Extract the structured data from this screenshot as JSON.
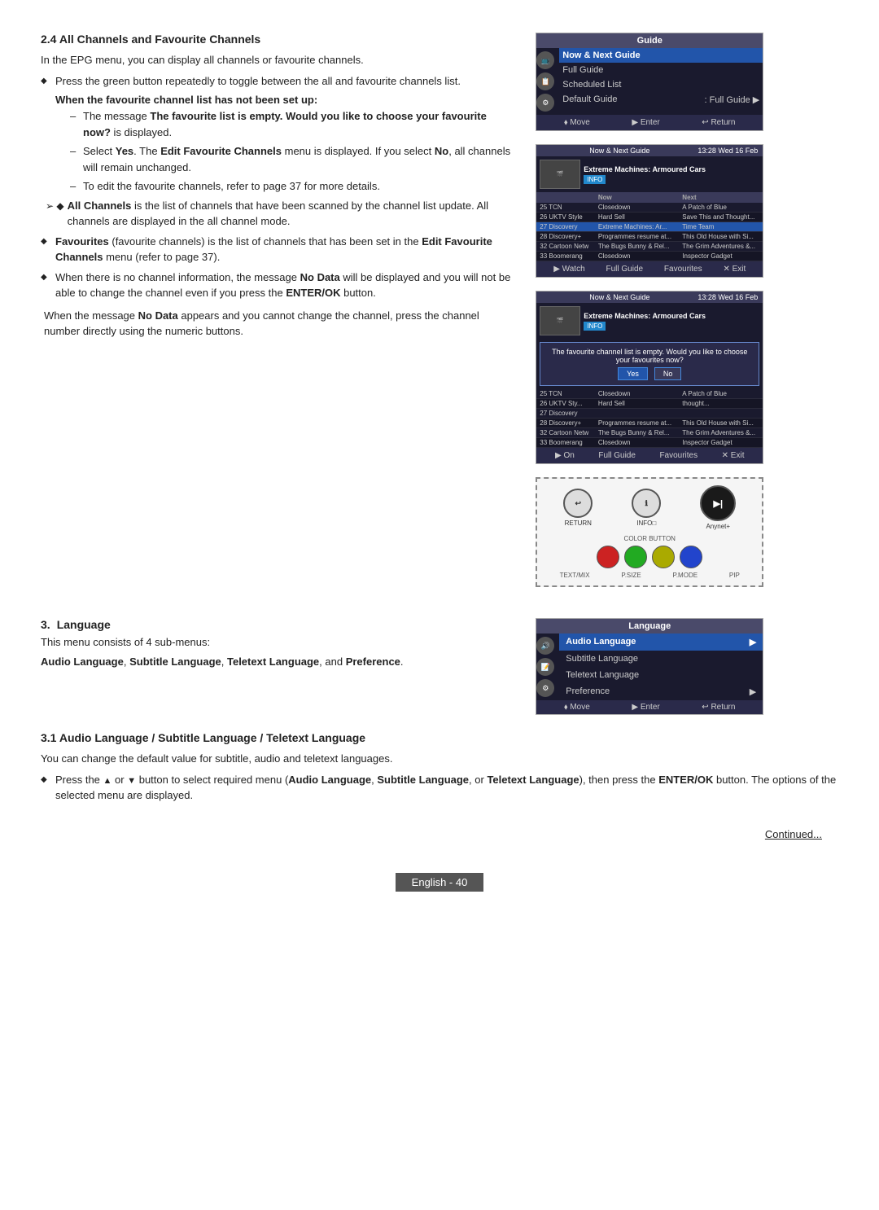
{
  "section24": {
    "title": "2.4  All Channels and Favourite Channels",
    "intro": "In the EPG menu, you can display all channels or favourite channels.",
    "bullets": [
      "Press the green button repeatedly to toggle between the all and favourite channels list."
    ],
    "when_title": "When the favourite channel list has not been set up:",
    "when_dashes": [
      "The message The favourite list is empty. Would you like to choose your favourite now? is displayed.",
      "Select Yes. The Edit Favourite Channels menu is displayed. If you select No, all channels will remain unchanged.",
      "To edit the favourite channels, refer to page 37 for more details."
    ],
    "arrow_bullet": "All Channels is the list of channels that have been scanned by the channel list update. All channels are displayed in the all channel mode.",
    "bullets2": [
      "Favourites (favourite channels) is the list of channels that has been set in the Edit Favourite Channels menu (refer to page 37).",
      "When there is no channel information, the message No Data will be displayed and you will not be able to change the channel even if you press the ENTER/OK button."
    ],
    "no_data_note": "When the message No Data appears and you cannot change the channel, press the channel number directly using the numeric buttons."
  },
  "section3": {
    "number": "3.",
    "title": "Language",
    "intro": "This menu consists of 4 sub-menus:",
    "sub_menus": "Audio Language, Subtitle Language, Teletext Language, and Preference."
  },
  "section31": {
    "title": "3.1  Audio Language / Subtitle Language / Teletext Language",
    "intro": "You can change the default value for subtitle, audio and teletext languages.",
    "bullet": "Press the ▲ or ▼ button to select required menu (Audio Language, Subtitle Language, or Teletext Language), then press the ENTER/OK button. The options of the selected menu are displayed."
  },
  "continued": "Continued...",
  "footer": "English - 40",
  "guide_ui": {
    "title": "Guide",
    "items": [
      {
        "label": "Now & Next Guide",
        "selected": true
      },
      {
        "label": "Full Guide",
        "selected": false
      },
      {
        "label": "Scheduled List",
        "selected": false
      },
      {
        "label": "Default Guide    : Full Guide",
        "selected": false,
        "arrow": true
      }
    ],
    "footer": [
      "⬧ Move",
      "▶ Enter",
      "↩ Return"
    ]
  },
  "now_next_ui": {
    "title": "Now & Next Guide",
    "date": "13:28 Wed 16 Feb",
    "featured_title": "Extreme Machines: Armoured Cars",
    "badge": "INFO",
    "columns": [
      "",
      "Now",
      "Next"
    ],
    "rows": [
      {
        "ch": "25",
        "name": "TCN",
        "now": "Closedown",
        "next": "A Patch of Blue"
      },
      {
        "ch": "26",
        "name": "UKTV Style",
        "now": "Hard Sell",
        "next": "Save This and Thought..."
      },
      {
        "ch": "27",
        "name": "Discovery",
        "now": "Extreme Machines: Ar...",
        "next": "Time Team"
      },
      {
        "ch": "28",
        "name": "Discovery+",
        "now": "Programmes resume at...",
        "next": "This Old House with Si..."
      },
      {
        "ch": "32",
        "name": "Cartoon Netw",
        "now": "The Bugs Bunny & Rel...",
        "next": "The Grim Adventures &..."
      },
      {
        "ch": "33",
        "name": "Boomerang",
        "now": "Closedown",
        "next": "Inspector Gadget"
      }
    ],
    "footer": [
      "▶ Watch",
      "Full Guide",
      "Favourites",
      "✕ Exit"
    ]
  },
  "now_next_dialog_ui": {
    "title": "Now & Next Guide",
    "date": "13:28 Wed 16 Feb",
    "featured_title": "Extreme Machines: Armoured Cars",
    "badge": "INFO",
    "dialog_text": "The favourite channel list is empty. Would you like to choose your favourites now?",
    "btn_yes": "Yes",
    "btn_no": "No",
    "rows": [
      {
        "ch": "25",
        "name": "TCN",
        "now": "Closedown",
        "next": "A Patch of Blue"
      },
      {
        "ch": "26",
        "name": "UKTV Sty...",
        "now": "Hard Sell",
        "next": "thought..."
      },
      {
        "ch": "27",
        "name": "Discovery",
        "now": "",
        "next": ""
      },
      {
        "ch": "28",
        "name": "Discovery+",
        "now": "Programmes resume at...",
        "next": "This Old House with Si..."
      },
      {
        "ch": "32",
        "name": "Cartoon Netw",
        "now": "The Bugs Bunny & Rel...",
        "next": "The Grim Adventures &..."
      },
      {
        "ch": "33",
        "name": "Boomerang",
        "now": "Closedown",
        "next": "Inspector Gadget"
      }
    ],
    "footer": [
      "▶ On",
      "Full Guide",
      "Favourites",
      "✕ Exit"
    ]
  },
  "remote_ui": {
    "return_label": "RETURN",
    "info_label": "INFO□",
    "anynet_label": "Anynet+",
    "color_button_label": "COLOR BUTTON",
    "bottom_labels": [
      "TEXT/MIX",
      "P.SIZE",
      "P.MODE",
      "PIP"
    ]
  },
  "language_ui": {
    "title": "Language",
    "items": [
      {
        "label": "Audio Language",
        "selected": true,
        "arrow": true
      },
      {
        "label": "Subtitle Language",
        "selected": false
      },
      {
        "label": "Teletext Language",
        "selected": false
      },
      {
        "label": "Preference",
        "selected": false,
        "arrow": true
      }
    ],
    "footer": [
      "⬧ Move",
      "▶ Enter",
      "↩ Return"
    ]
  }
}
